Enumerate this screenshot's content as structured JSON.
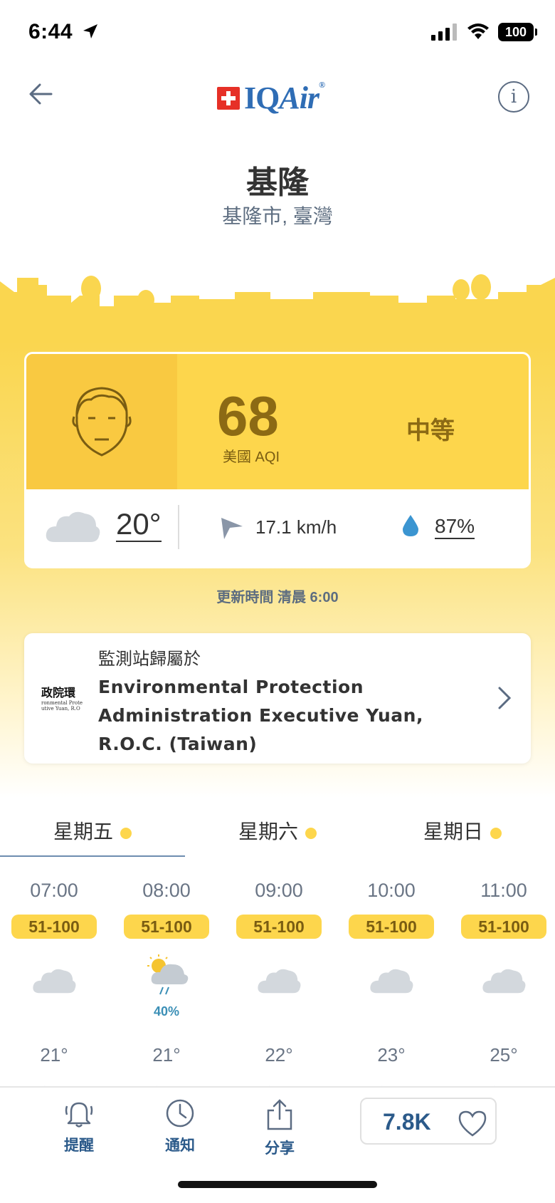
{
  "status": {
    "time": "6:44",
    "battery": "100"
  },
  "header": {
    "logo_text_a": "IQ",
    "logo_text_b": "Air",
    "logo_mark": "®"
  },
  "location": {
    "city": "基隆",
    "region": "基隆市, 臺灣"
  },
  "aqi": {
    "value": "68",
    "label": "美國 AQI",
    "level": "中等",
    "face_color": "#f9c941",
    "bg_color": "#fdd64c"
  },
  "weather": {
    "temp": "20°",
    "wind": "17.1 km/h",
    "humidity": "87%"
  },
  "updated": "更新時間 清晨 6:00",
  "station": {
    "title": "監測站歸屬於",
    "name": "Environmental Protection Administration Executive Yuan, R.O.C. (Taiwan)",
    "logo_big": "政院環",
    "logo_line1": "ronmental Prote",
    "logo_line2": "utive Yuan, R.O"
  },
  "days": [
    "星期五",
    "星期六",
    "星期日"
  ],
  "hours": [
    {
      "time": "07:00",
      "aqi": "51-100",
      "icon": "cloud-icon",
      "rain": "",
      "temp": "21°"
    },
    {
      "time": "08:00",
      "aqi": "51-100",
      "icon": "sun-rain-cloud-icon",
      "rain": "40%",
      "temp": "21°"
    },
    {
      "time": "09:00",
      "aqi": "51-100",
      "icon": "cloud-icon",
      "rain": "",
      "temp": "22°"
    },
    {
      "time": "10:00",
      "aqi": "51-100",
      "icon": "cloud-icon",
      "rain": "",
      "temp": "23°"
    },
    {
      "time": "11:00",
      "aqi": "51-100",
      "icon": "cloud-icon",
      "rain": "",
      "temp": "25°"
    }
  ],
  "bottom": {
    "alerts": "提醒",
    "notify": "通知",
    "share": "分享",
    "likes": "7.8K"
  }
}
